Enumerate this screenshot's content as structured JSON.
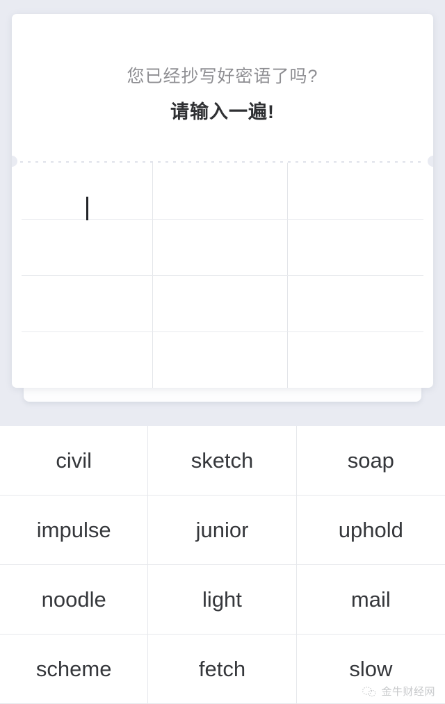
{
  "card": {
    "prompt_sub": "您已经抄写好密语了吗?",
    "prompt_main": "请输入一遍!",
    "input_value": "",
    "caret_visible": true,
    "grid": {
      "columns": 3,
      "rows": 4
    }
  },
  "word_bank": {
    "columns": 3,
    "rows": [
      [
        "civil",
        "sketch",
        "soap"
      ],
      [
        "impulse",
        "junior",
        "uphold"
      ],
      [
        "noodle",
        "light",
        "mail"
      ],
      [
        "scheme",
        "fetch",
        "slow"
      ]
    ]
  },
  "watermark": {
    "text": "金牛财经网",
    "logo": "wechat-circle-logo"
  },
  "colors": {
    "page_background": "#e9ebf2",
    "card_background": "#ffffff",
    "prompt_sub_color": "#8e8e92",
    "prompt_main_color": "#2f3033",
    "grid_line": "#e3e5e9",
    "word_text": "#35373b",
    "caret": "#222428"
  }
}
